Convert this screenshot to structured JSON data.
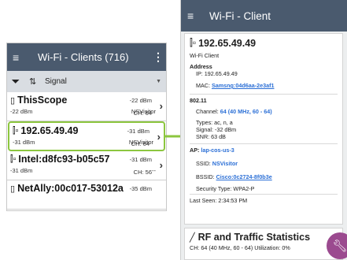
{
  "left": {
    "header": {
      "menu_icon": "≡",
      "title": "Wi-Fi - Clients (716)",
      "more_icon": "⋮"
    },
    "filter": {
      "filter_icon": "▼",
      "sort_icon": "⇅",
      "sort_value": "Signal",
      "dropdown_icon": "▼"
    },
    "rows": [
      {
        "icon": "▯",
        "name": "ThisScope",
        "sub_left": "-22 dBm",
        "ssid": "NSVisitor",
        "dbm": "-22 dBm",
        "ch": "CH: 64"
      },
      {
        "icon": "⏻",
        "name": "192.65.49.49",
        "sub_left": "-31 dBm",
        "ssid": "NSVisitor",
        "dbm": "-31 dBm",
        "ch": "CH: 64"
      },
      {
        "icon": "▭",
        "name": "Intel:d8fc93-b05c57",
        "sub_left": "-31 dBm",
        "ssid": "--",
        "dbm": "-31 dBm",
        "ch": "CH: 56"
      },
      {
        "icon": "▯",
        "name": "NetAlly:00c017-53012a",
        "sub_left": "",
        "ssid": "",
        "dbm": "-35 dBm",
        "ch": ""
      }
    ]
  },
  "right": {
    "header": {
      "menu_icon": "≡",
      "title": "Wi-Fi - Client"
    },
    "card": {
      "ip": "192.65.49.49",
      "type": "Wi-Fi Client",
      "address_label": "Address",
      "ip_line": "IP: 192.65.49.49",
      "mac_label": "MAC:",
      "mac": "Samsng:04d6aa-2e3af1",
      "std": "802.11",
      "channel_label": "Channel:",
      "channel": "64 (40 MHz, 60 - 64)",
      "types": "Types: ac, n, a",
      "signal": "Signal: -32 dBm",
      "snr": "SNR: 63 dB",
      "ap_label": "AP:",
      "ap": "lap-cos-us-3",
      "ssid_label": "SSID:",
      "ssid": "NSVisitor",
      "bssid_label": "BSSID:",
      "bssid": "Cisco:0c2724-8f0b3e",
      "security": "Security Type:  WPA2-P",
      "last_seen": "Last Seen: 2:34:53 PM"
    },
    "card2": {
      "icon": "⌞",
      "title": "RF and Traffic Statistics",
      "sub": "CH: 64 (40 MHz, 60 - 64)   Utilization:  0%"
    },
    "fab_icon": "✎"
  },
  "colors": {
    "header": "#4a5a6e",
    "accent_green": "#8cc63f",
    "link": "#2b6fd6",
    "fab": "#9b4a8f"
  }
}
